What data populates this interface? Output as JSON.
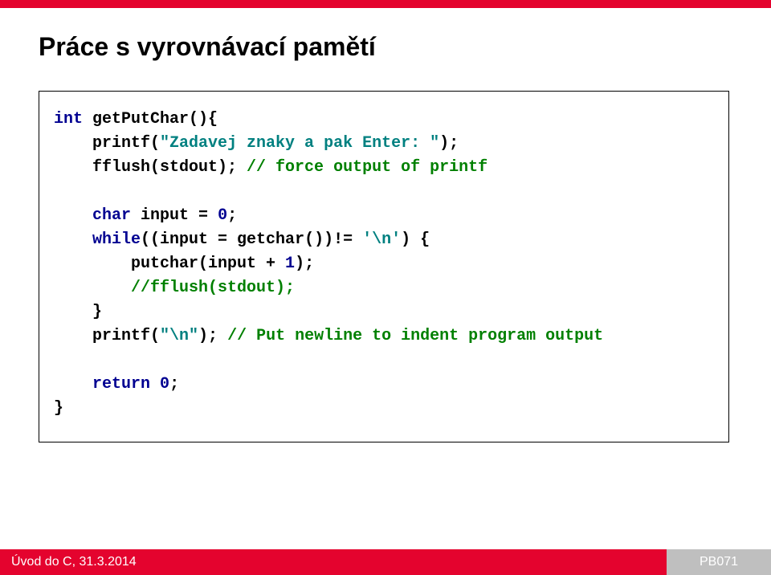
{
  "title": "Práce s vyrovnávací pamětí",
  "code": {
    "kw_int": "int",
    "fn_decl": " getPutChar(){",
    "l2a": "    printf(",
    "l2s": "\"Zadavej znaky a pak Enter: \"",
    "l2b": ");",
    "l3a": "    fflush(stdout); ",
    "l3c": "// force output of printf",
    "kw_char": "char",
    "l5a": " input = ",
    "num0": "0",
    "l5b": ";",
    "kw_while": "while",
    "l6a": "((input = getchar())!= ",
    "l6s": "'\\n'",
    "l6b": ") {",
    "l7a": "        putchar(input + ",
    "num1": "1",
    "l7b": ");",
    "l8c": "        //fflush(stdout);",
    "l9": "    }",
    "l10a": "    printf(",
    "l10s": "\"\\n\"",
    "l10b": "); ",
    "l10c": "// Put newline to indent program output",
    "kw_return": "return",
    "l12a": " ",
    "num0b": "0",
    "l12b": ";",
    "brace_close": "}"
  },
  "footer": {
    "left": "Úvod do C, 31.3.2014",
    "right": "PB071"
  }
}
